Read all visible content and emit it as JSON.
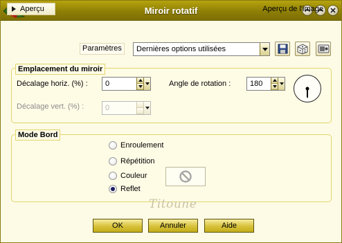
{
  "window": {
    "title": "Miroir rotatif",
    "accent": "#8e7f06",
    "background": "#fdfbe6"
  },
  "titlebar_buttons": [
    {
      "icon": "help-icon"
    },
    {
      "icon": "minimize-icon"
    },
    {
      "icon": "close-icon"
    }
  ],
  "preview": {
    "toggle_label": "Aperçu",
    "image_preview_label": "Aperçu de l'image"
  },
  "presets": {
    "label": "Paramètres",
    "selected": "Dernières options utilisées",
    "icons": [
      "save-preset-icon",
      "randomize-dice-icon",
      "reset-preset-icon"
    ]
  },
  "mirror_location": {
    "title": "Emplacement du miroir",
    "horiz_offset_label": "Décalage horiz. (%) :",
    "horiz_offset_value": "0",
    "vert_offset_label": "Décalage vert. (%) :",
    "vert_offset_value": "0",
    "rotation_label": "Angle de rotation :",
    "rotation_value": "180"
  },
  "edge_mode": {
    "title": "Mode Bord",
    "options": [
      {
        "label": "Enroulement",
        "checked": false
      },
      {
        "label": "Répétition",
        "checked": false
      },
      {
        "label": "Couleur",
        "checked": false
      },
      {
        "label": "Reflet",
        "checked": true
      }
    ]
  },
  "watermark": "Titoune",
  "footer": {
    "ok_label": "OK",
    "cancel_label": "Annuler",
    "help_label": "Aide"
  }
}
